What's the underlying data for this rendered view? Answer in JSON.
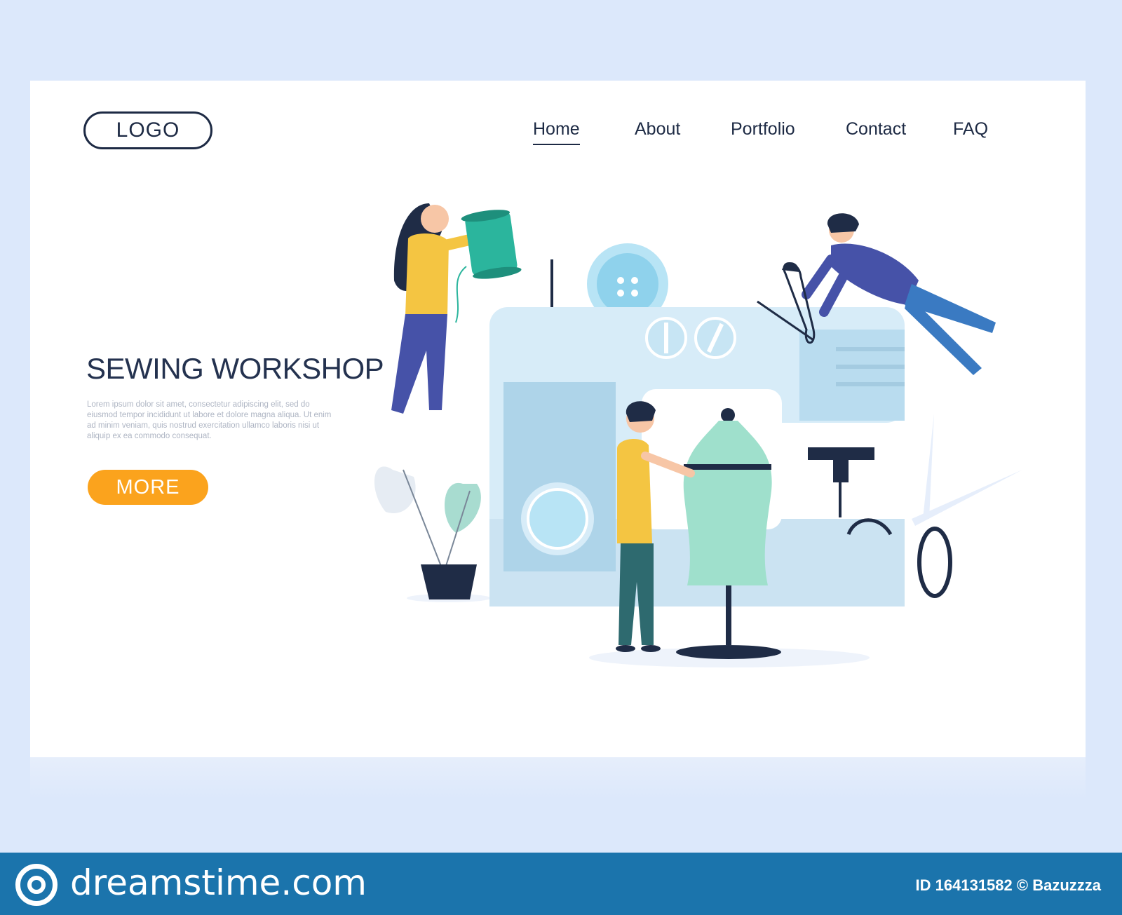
{
  "logo": "LOGO",
  "nav": {
    "items": [
      "Home",
      "About",
      "Portfolio",
      "Contact",
      "FAQ"
    ]
  },
  "hero": {
    "title": "SEWING WORKSHOP",
    "text": "Lorem ipsum dolor sit amet, consectetur adipiscing elit, sed do eiusmod tempor incididunt ut labore et dolore magna aliqua. Ut enim ad minim veniam, quis nostrud exercitation ullamco laboris nisi ut aliquip ex ea commodo consequat.",
    "button": "MORE"
  },
  "watermark": {
    "brand": "dreamstime.com",
    "id_text": "ID 164131582 © Bazuzzza"
  },
  "colors": {
    "accent": "#fba31d",
    "text_dark": "#1d2a44",
    "background": "#dce8fb",
    "watermark_bar": "#1b74ac"
  }
}
